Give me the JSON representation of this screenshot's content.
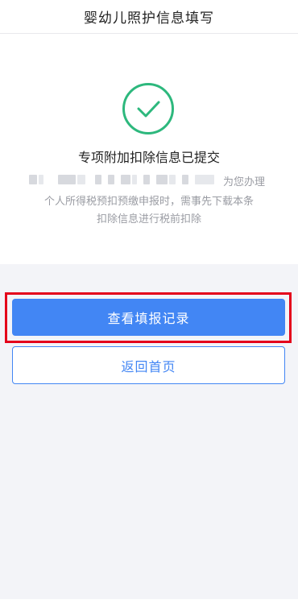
{
  "header": {
    "title": "婴幼儿照护信息填写"
  },
  "status": {
    "title": "专项附加扣除信息已提交",
    "desc_tail": "为您办理",
    "desc_line2": "个人所得税预扣预缴申报时，需事先下载本条",
    "desc_line3": "扣除信息进行税前扣除"
  },
  "buttons": {
    "view_records": "查看填报记录",
    "back_home": "返回首页"
  },
  "colors": {
    "accent": "#4286f4",
    "success": "#2db87d",
    "highlight": "#e4001b"
  },
  "icons": {
    "status": "check-circle-icon"
  }
}
